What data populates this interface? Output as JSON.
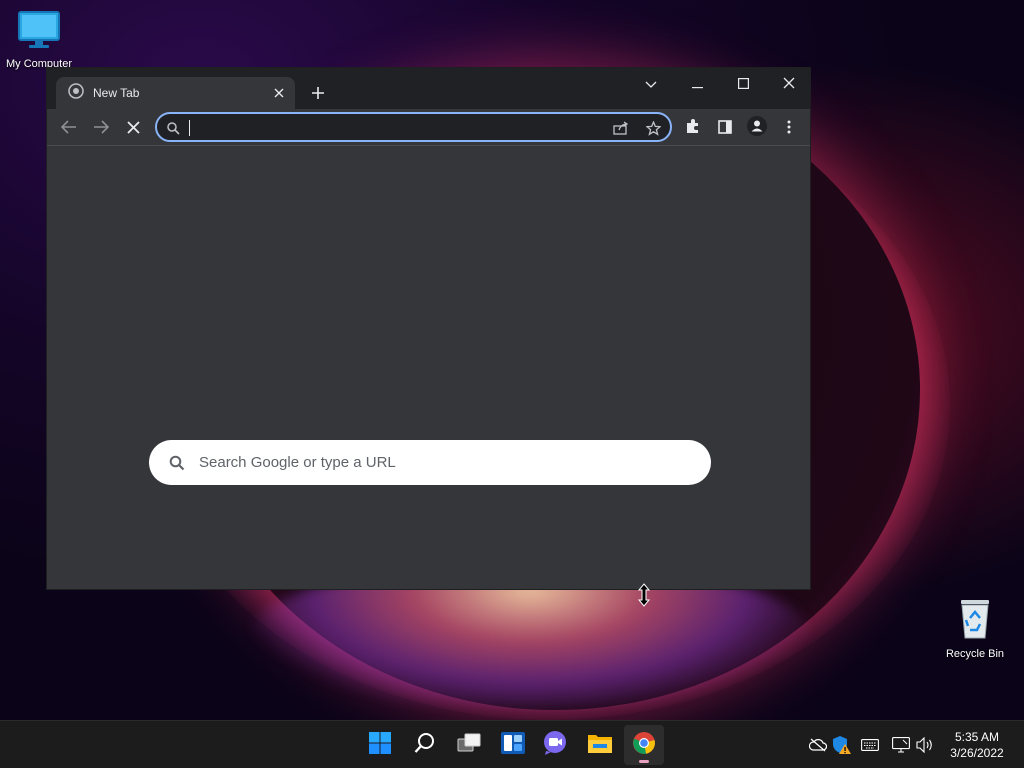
{
  "desktop": {
    "icons": [
      {
        "label": "My Computer",
        "icon": "computer-icon"
      },
      {
        "label": "Recycle Bin",
        "icon": "recycle-bin-icon"
      }
    ]
  },
  "browser": {
    "tab": {
      "title": "New Tab",
      "favicon": "chrome-newtab-icon"
    },
    "window_controls": [
      "tab-search",
      "minimize",
      "maximize",
      "close"
    ],
    "toolbar": {
      "buttons": [
        "back",
        "forward",
        "stop",
        "extensions",
        "side-panel",
        "profile",
        "menu"
      ],
      "omnibox": {
        "value": "",
        "placeholder": "",
        "icons": [
          "search-icon",
          "share-icon",
          "bookmark-star-icon"
        ]
      }
    },
    "new_tab_page": {
      "search_placeholder": "Search Google or type a URL"
    }
  },
  "taskbar": {
    "apps": [
      "start",
      "search",
      "task-view",
      "widgets",
      "teams-chat",
      "file-explorer",
      "chrome"
    ],
    "active_app": "chrome",
    "tray": [
      "onedrive-offline",
      "defender-warning",
      "keyboard",
      "network",
      "volume"
    ],
    "clock": {
      "time": "5:35 AM",
      "date": "3/26/2022"
    }
  },
  "colors": {
    "accent": "#8ab4f8",
    "browser_frame": "#202124",
    "browser_surface": "#35363a",
    "taskbar": "#1c1c1c"
  }
}
